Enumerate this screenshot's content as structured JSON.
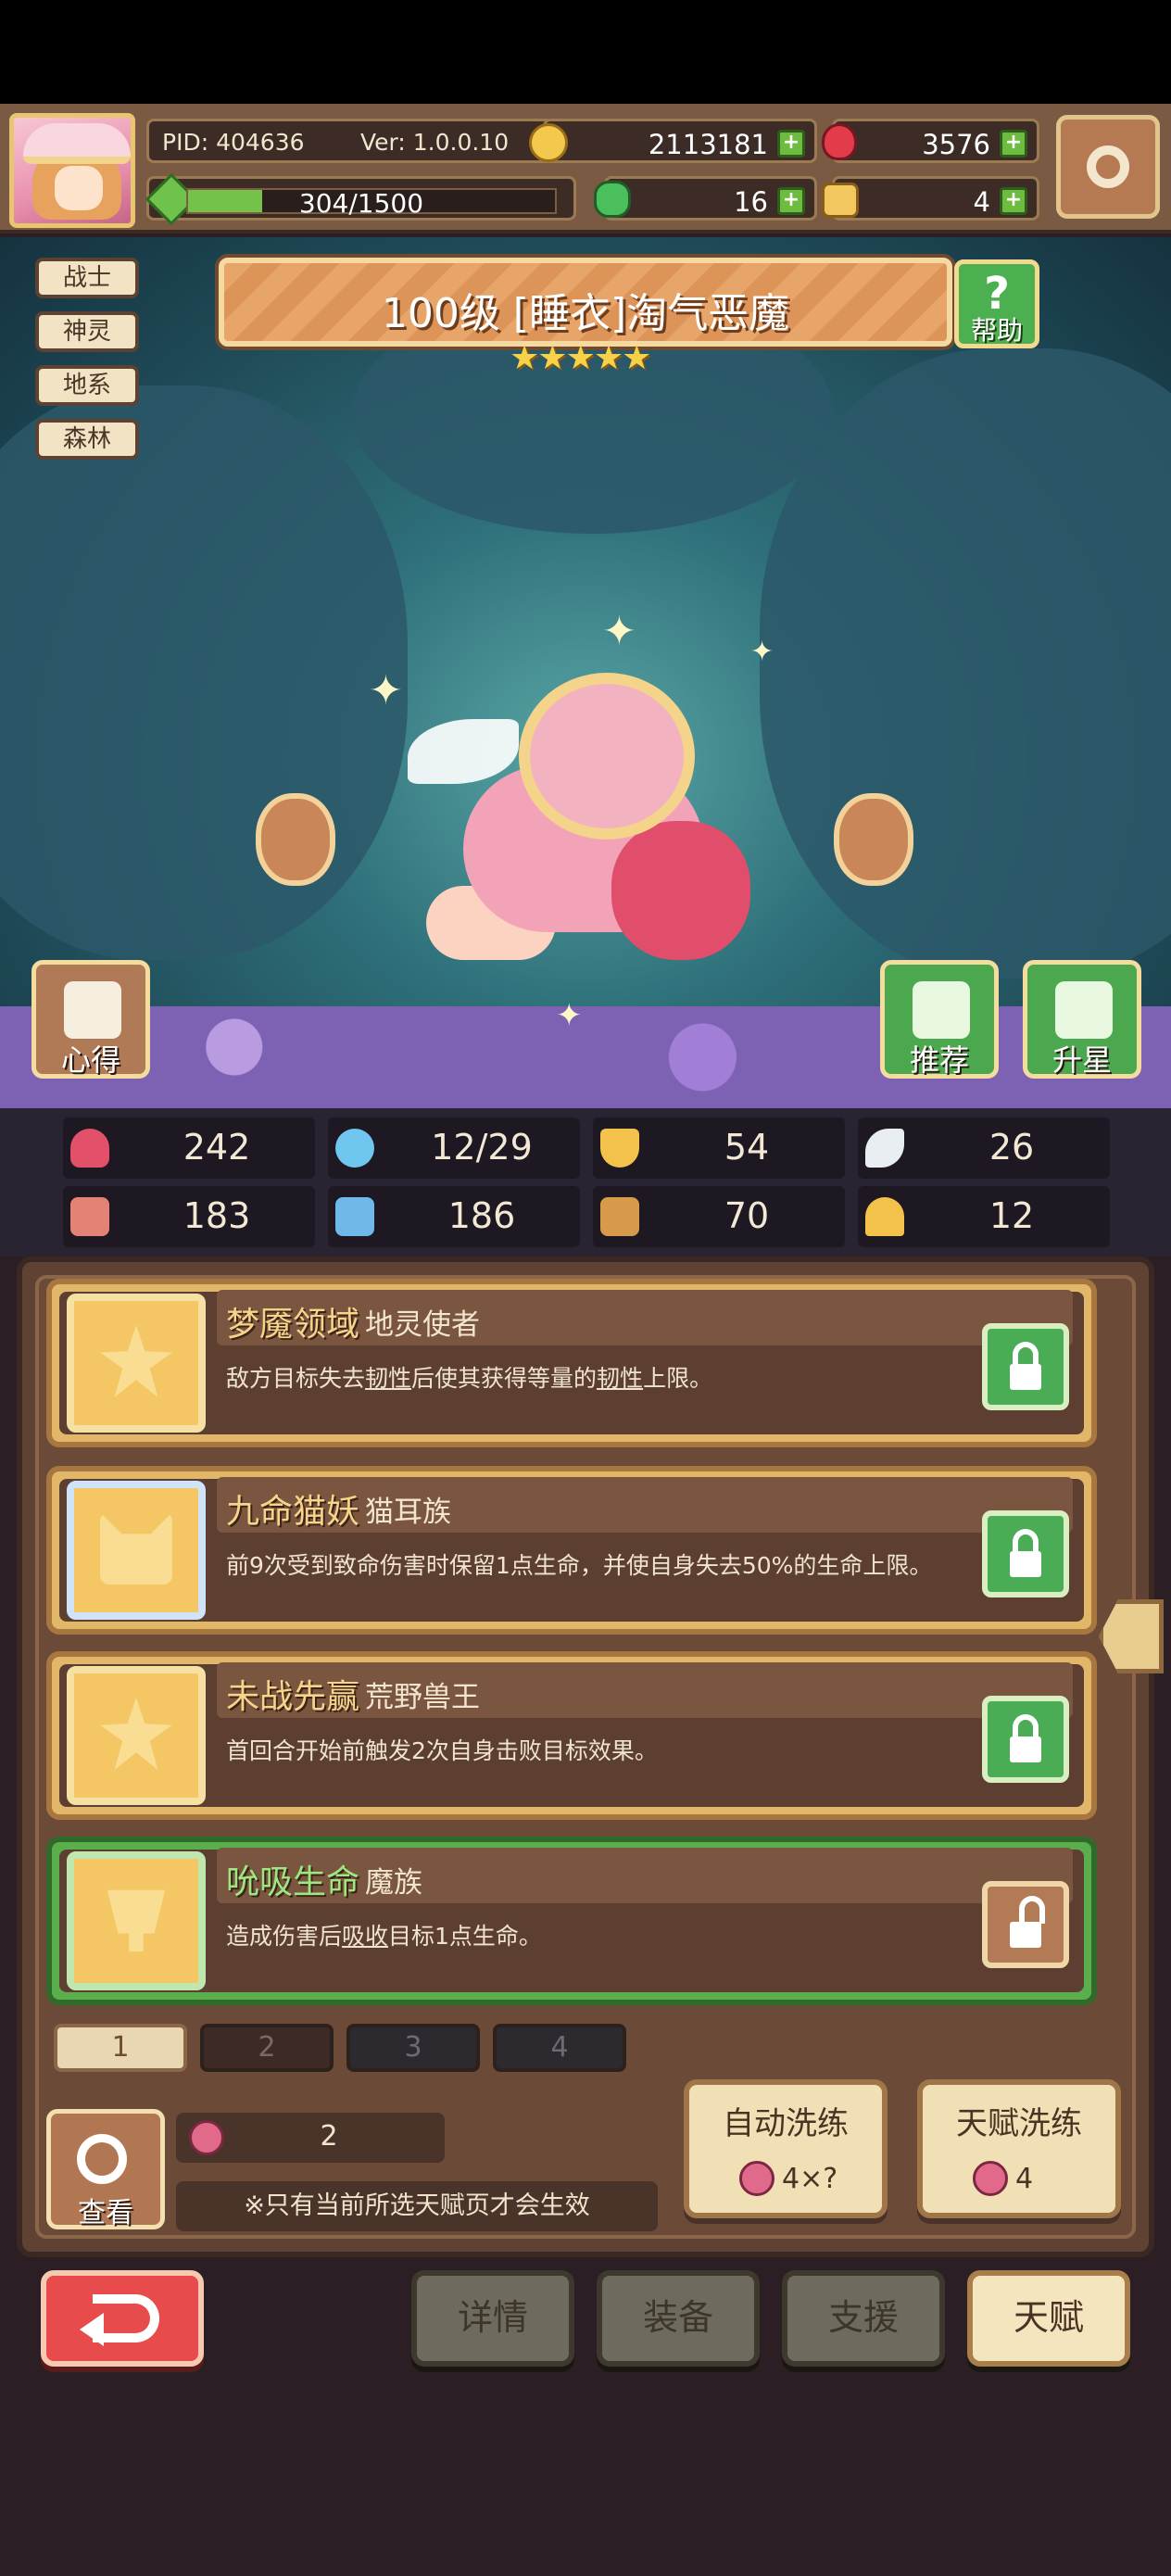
{
  "hud": {
    "pid": "PID: 404636",
    "ver": "Ver: 1.0.0.10",
    "xp_text": "304/1500",
    "xp_fraction": 0.2027,
    "gold": "2113181",
    "ruby": "3576",
    "clover": "16",
    "scroll": "4"
  },
  "hero": {
    "tags": [
      "战士",
      "神灵",
      "地系",
      "森林"
    ],
    "title": "100级 [睡衣]淘气恶魔",
    "stars": 5,
    "help_label": "帮助",
    "notes_label": "心得",
    "recommend_label": "推荐",
    "star_up_label": "升星"
  },
  "stats": [
    {
      "icon": "heart-icon",
      "value": "242"
    },
    {
      "icon": "drop-icon",
      "value": "12/29"
    },
    {
      "icon": "shield-icon",
      "value": "54"
    },
    {
      "icon": "wing-icon",
      "value": "26"
    },
    {
      "icon": "fist-icon",
      "value": "183"
    },
    {
      "icon": "book-icon",
      "value": "186"
    },
    {
      "icon": "boot-icon",
      "value": "70"
    },
    {
      "icon": "horseshoe-icon",
      "value": "12"
    }
  ],
  "talents": [
    {
      "name": "梦魇领域",
      "race": "地灵使者",
      "desc_parts": [
        "敌方目标失去",
        "韧性",
        "后使其获得等量的",
        "韧性",
        "上限。"
      ],
      "locked": true
    },
    {
      "name": "九命猫妖",
      "race": "猫耳族",
      "desc": "前9次受到致命伤害时保留1点生命，并使自身失去50%的生命上限。",
      "locked": true
    },
    {
      "name": "未战先赢",
      "race": "荒野兽王",
      "desc": "首回合开始前触发2次自身击败目标效果。",
      "locked": true
    },
    {
      "name": "吮吸生命",
      "race": "魔族",
      "desc_parts": [
        "造成伤害后",
        "吸收",
        "目标1点生命。"
      ],
      "locked": false
    }
  ],
  "pages": [
    "1",
    "2",
    "3",
    "4"
  ],
  "footer": {
    "view_label": "查看",
    "berry_count": "2",
    "note": "※只有当前所选天赋页才会生效",
    "auto_refine_label": "自动洗练",
    "auto_refine_cost": "4×?",
    "talent_refine_label": "天赋洗练",
    "talent_refine_cost": "4"
  },
  "nav": {
    "details": "详情",
    "equipment": "装备",
    "support": "支援",
    "talent": "天赋"
  },
  "colors": {
    "accent_green": "#5aae4c",
    "gold_banner": "#e8a56a",
    "back_red": "#e74b4b"
  }
}
